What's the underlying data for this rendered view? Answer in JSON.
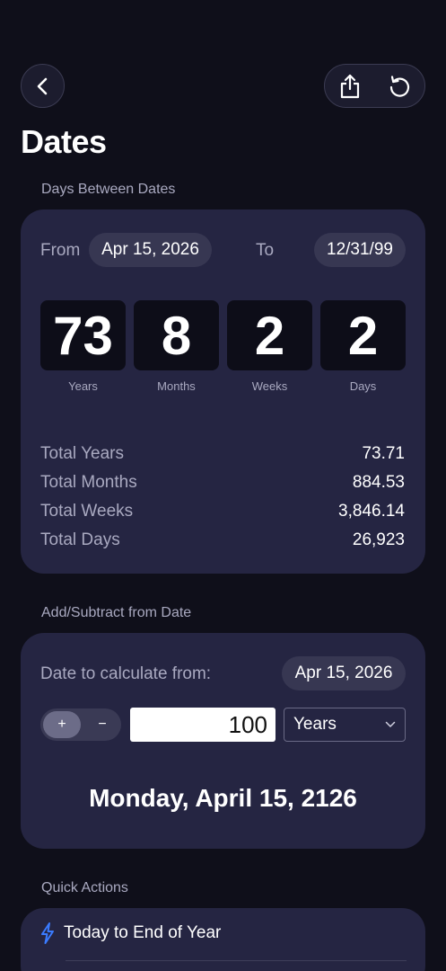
{
  "header": {
    "title": "Dates",
    "back_icon": "chevron-left-icon",
    "share_icon": "share-icon",
    "reset_icon": "rotate-ccw-icon"
  },
  "days_between": {
    "section_label": "Days Between Dates",
    "from_label": "From",
    "from_value": "Apr 15, 2026",
    "to_label": "To",
    "to_value": "12/31/99",
    "units": [
      {
        "value": "73",
        "label": "Years"
      },
      {
        "value": "8",
        "label": "Months"
      },
      {
        "value": "2",
        "label": "Weeks"
      },
      {
        "value": "2",
        "label": "Days"
      }
    ],
    "totals": [
      {
        "label": "Total Years",
        "value": "73.71"
      },
      {
        "label": "Total Months",
        "value": "884.53"
      },
      {
        "label": "Total Weeks",
        "value": "3,846.14"
      },
      {
        "label": "Total Days",
        "value": "26,923"
      }
    ]
  },
  "add_subtract": {
    "section_label": "Add/Subtract from Date",
    "date_label": "Date to calculate from:",
    "date_value": "Apr 15, 2026",
    "plus_label": "+",
    "minus_label": "−",
    "amount": "100",
    "unit": "Years",
    "result": "Monday, April 15, 2126"
  },
  "quick_actions": {
    "section_label": "Quick Actions",
    "items": [
      {
        "label": "Today to End of Year",
        "icon": "lightning-bolt-icon"
      }
    ]
  },
  "colors": {
    "background": "#0f0f1a",
    "card": "#252542",
    "accent": "#3a7bff"
  }
}
